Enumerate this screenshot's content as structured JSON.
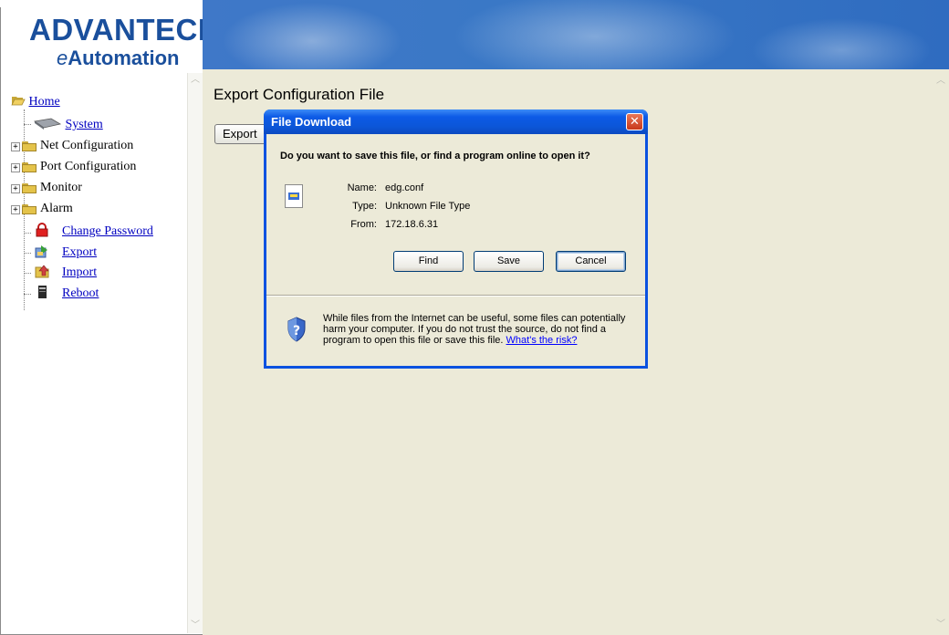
{
  "header": {
    "logo": "ADVANTECH",
    "tagline_prefix": "e",
    "tagline_rest": "Automation"
  },
  "nav": {
    "items": [
      {
        "label": "Home",
        "icon": "open-folder-icon",
        "link": true
      },
      {
        "label": "System",
        "icon": "system-icon",
        "link": true
      },
      {
        "label": "Net Configuration",
        "icon": "folder-icon",
        "link": false,
        "expandable": true
      },
      {
        "label": "Port Configuration",
        "icon": "folder-icon",
        "link": false,
        "expandable": true
      },
      {
        "label": "Monitor",
        "icon": "folder-icon",
        "link": false,
        "expandable": true
      },
      {
        "label": "Alarm",
        "icon": "folder-icon",
        "link": false,
        "expandable": true
      },
      {
        "label": "Change Password",
        "icon": "lock-icon",
        "link": true
      },
      {
        "label": "Export",
        "icon": "export-icon",
        "link": true
      },
      {
        "label": "Import",
        "icon": "import-icon",
        "link": true
      },
      {
        "label": "Reboot",
        "icon": "reboot-icon",
        "link": true
      }
    ]
  },
  "main": {
    "title": "Export Configuration File",
    "export_button": "Export"
  },
  "dialog": {
    "title": "File Download",
    "question": "Do you want to save this file, or find a program online to open it?",
    "name_label": "Name:",
    "name_value": "edg.conf",
    "type_label": "Type:",
    "type_value": "Unknown File Type",
    "from_label": "From:",
    "from_value": "172.18.6.31",
    "find_button": "Find",
    "save_button": "Save",
    "cancel_button": "Cancel",
    "warning_text": "While files from the Internet can be useful, some files can potentially harm your computer. If you do not trust the source, do not find a program to open this file or save this file.",
    "risk_link": "What's the risk?"
  },
  "colors": {
    "brand": "#1a4f9c",
    "dialog_title": "#0a52e0",
    "dialog_body": "#ecead8",
    "link": "#0000c0"
  }
}
